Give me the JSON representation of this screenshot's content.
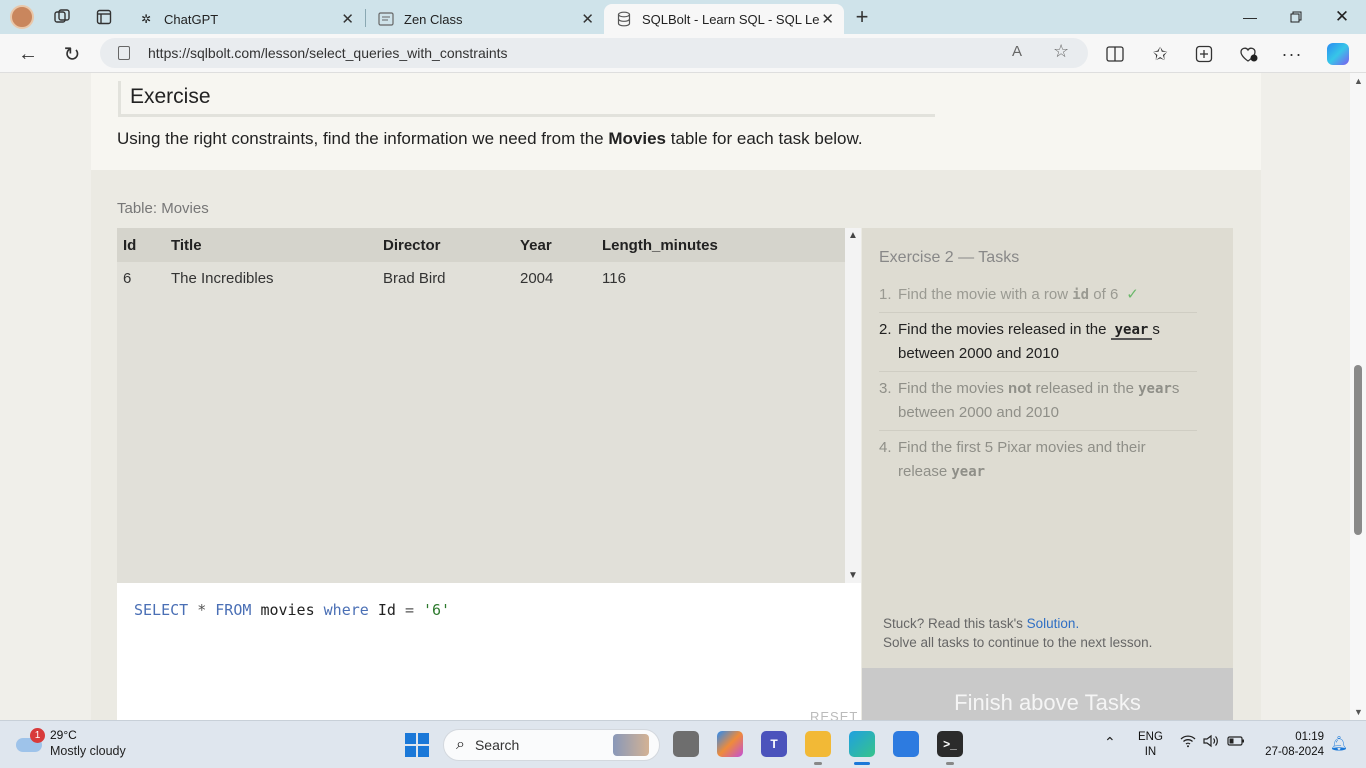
{
  "browser": {
    "tabs": [
      {
        "label": "ChatGPT",
        "icon": "chatgpt-icon"
      },
      {
        "label": "Zen Class",
        "icon": "page-icon"
      },
      {
        "label": "SQLBolt - Learn SQL - SQL Lesson",
        "icon": "database-icon",
        "active": true
      }
    ],
    "url": "https://sqlbolt.com/lesson/select_queries_with_constraints"
  },
  "exercise": {
    "heading": "Exercise",
    "intro_pre": "Using the right constraints, find the information we need from the ",
    "intro_bold": "Movies",
    "intro_post": " table for each task below.",
    "table_caption": "Table: Movies",
    "columns": [
      "Id",
      "Title",
      "Director",
      "Year",
      "Length_minutes"
    ],
    "rows": [
      [
        "6",
        "The Incredibles",
        "Brad Bird",
        "2004",
        "116"
      ]
    ],
    "query": {
      "select": "SELECT",
      "star": "*",
      "from": "FROM",
      "table": "movies",
      "where": "where",
      "col": "Id",
      "eq": "=",
      "value": "'6'"
    },
    "reset_label": "RESET"
  },
  "tasks": {
    "title": "Exercise 2 — Tasks",
    "items": [
      {
        "num": "1.",
        "pre": "Find the movie with a row ",
        "code": "id",
        "post": " of 6",
        "status": "done",
        "check": "✓"
      },
      {
        "num": "2.",
        "pre": "Find the movies released in the ",
        "code": "year",
        "post": "s between 2000 and 2010",
        "status": "active"
      },
      {
        "num": "3.",
        "pre": "Find the movies ",
        "bold": "not",
        "mid": " released in the ",
        "code": "year",
        "post": "s between 2000 and 2010",
        "status": "pending"
      },
      {
        "num": "4.",
        "pre": "Find the first 5 Pixar movies and their release ",
        "code": "year",
        "status": "pending"
      }
    ],
    "stuck_pre": "Stuck? Read this task's ",
    "stuck_link": "Solution.",
    "stuck_line2": "Solve all tasks to continue to the next lesson.",
    "finish_label": "Finish above Tasks"
  },
  "taskbar": {
    "weather_temp": "29°C",
    "weather_desc": "Mostly cloudy",
    "weather_badge": "1",
    "search_label": "Search",
    "lang_1": "ENG",
    "lang_2": "IN",
    "time": "01:19",
    "date": "27-08-2024"
  },
  "colors": {
    "accent": "#1a78d8",
    "keyword": "#4a6fb5",
    "string": "#2d7a2d",
    "link": "#2f6fc4"
  }
}
